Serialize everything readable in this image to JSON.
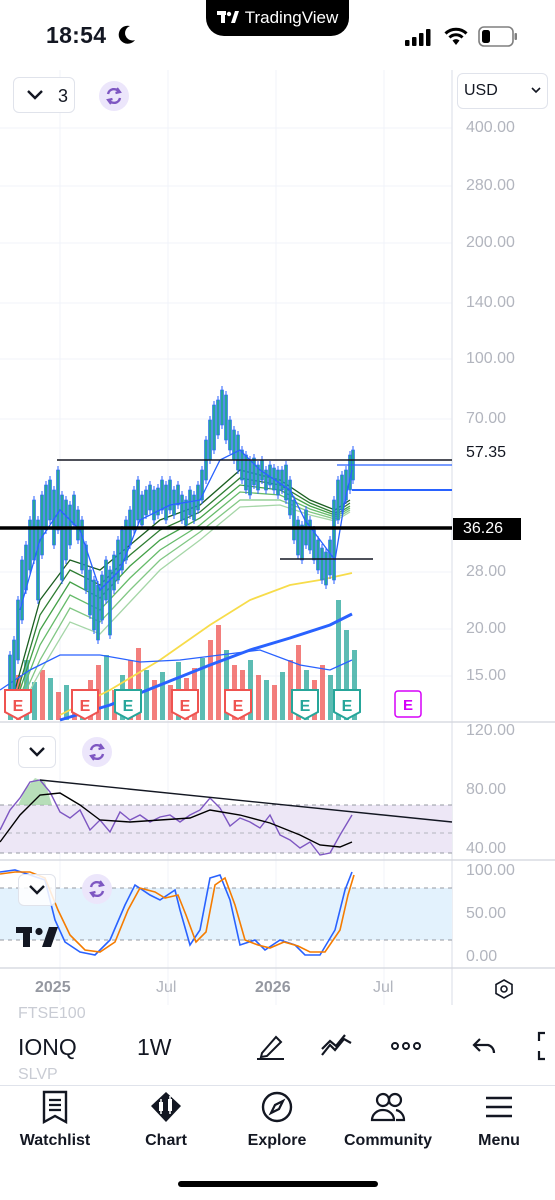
{
  "status_bar": {
    "time": "18:54",
    "app_pill": "TradingView"
  },
  "chart": {
    "indicator_count": "3",
    "currency": "USD",
    "price_axis": [
      "400.00",
      "280.00",
      "200.00",
      "140.00",
      "100.00",
      "70.00",
      "57.35",
      "28.00",
      "20.00",
      "15.00"
    ],
    "last_price_label": "57.35",
    "line_price_label": "36.26",
    "rsi_axis": [
      "120.00",
      "80.00",
      "40.00"
    ],
    "stoch_axis": [
      "100.00",
      "50.00",
      "0.00"
    ],
    "time_axis": [
      "2025",
      "Jul",
      "2026",
      "Jul"
    ],
    "earnings_badge": "E",
    "colors": {
      "candle_up": "#26a69a",
      "candle_edge": "#2962ff",
      "volume_up": "#26a69a",
      "volume_down": "#ef5350",
      "ma_long": "#2962ff",
      "ma_yellow": "#f7dc4a",
      "rsi_line": "#7e57c2",
      "stoch_k": "#2962ff",
      "stoch_d": "#f57c00",
      "accent": "#7e57c2"
    }
  },
  "symbol_bar": {
    "ghost_above": "FTSE100",
    "ticker": "IONQ",
    "interval": "1W",
    "ghost_below": "SLVP"
  },
  "nav": [
    {
      "label": "Watchlist",
      "icon": "watchlist-icon"
    },
    {
      "label": "Chart",
      "icon": "chart-icon"
    },
    {
      "label": "Explore",
      "icon": "compass-icon"
    },
    {
      "label": "Community",
      "icon": "community-icon"
    },
    {
      "label": "Menu",
      "icon": "menu-icon"
    }
  ]
}
